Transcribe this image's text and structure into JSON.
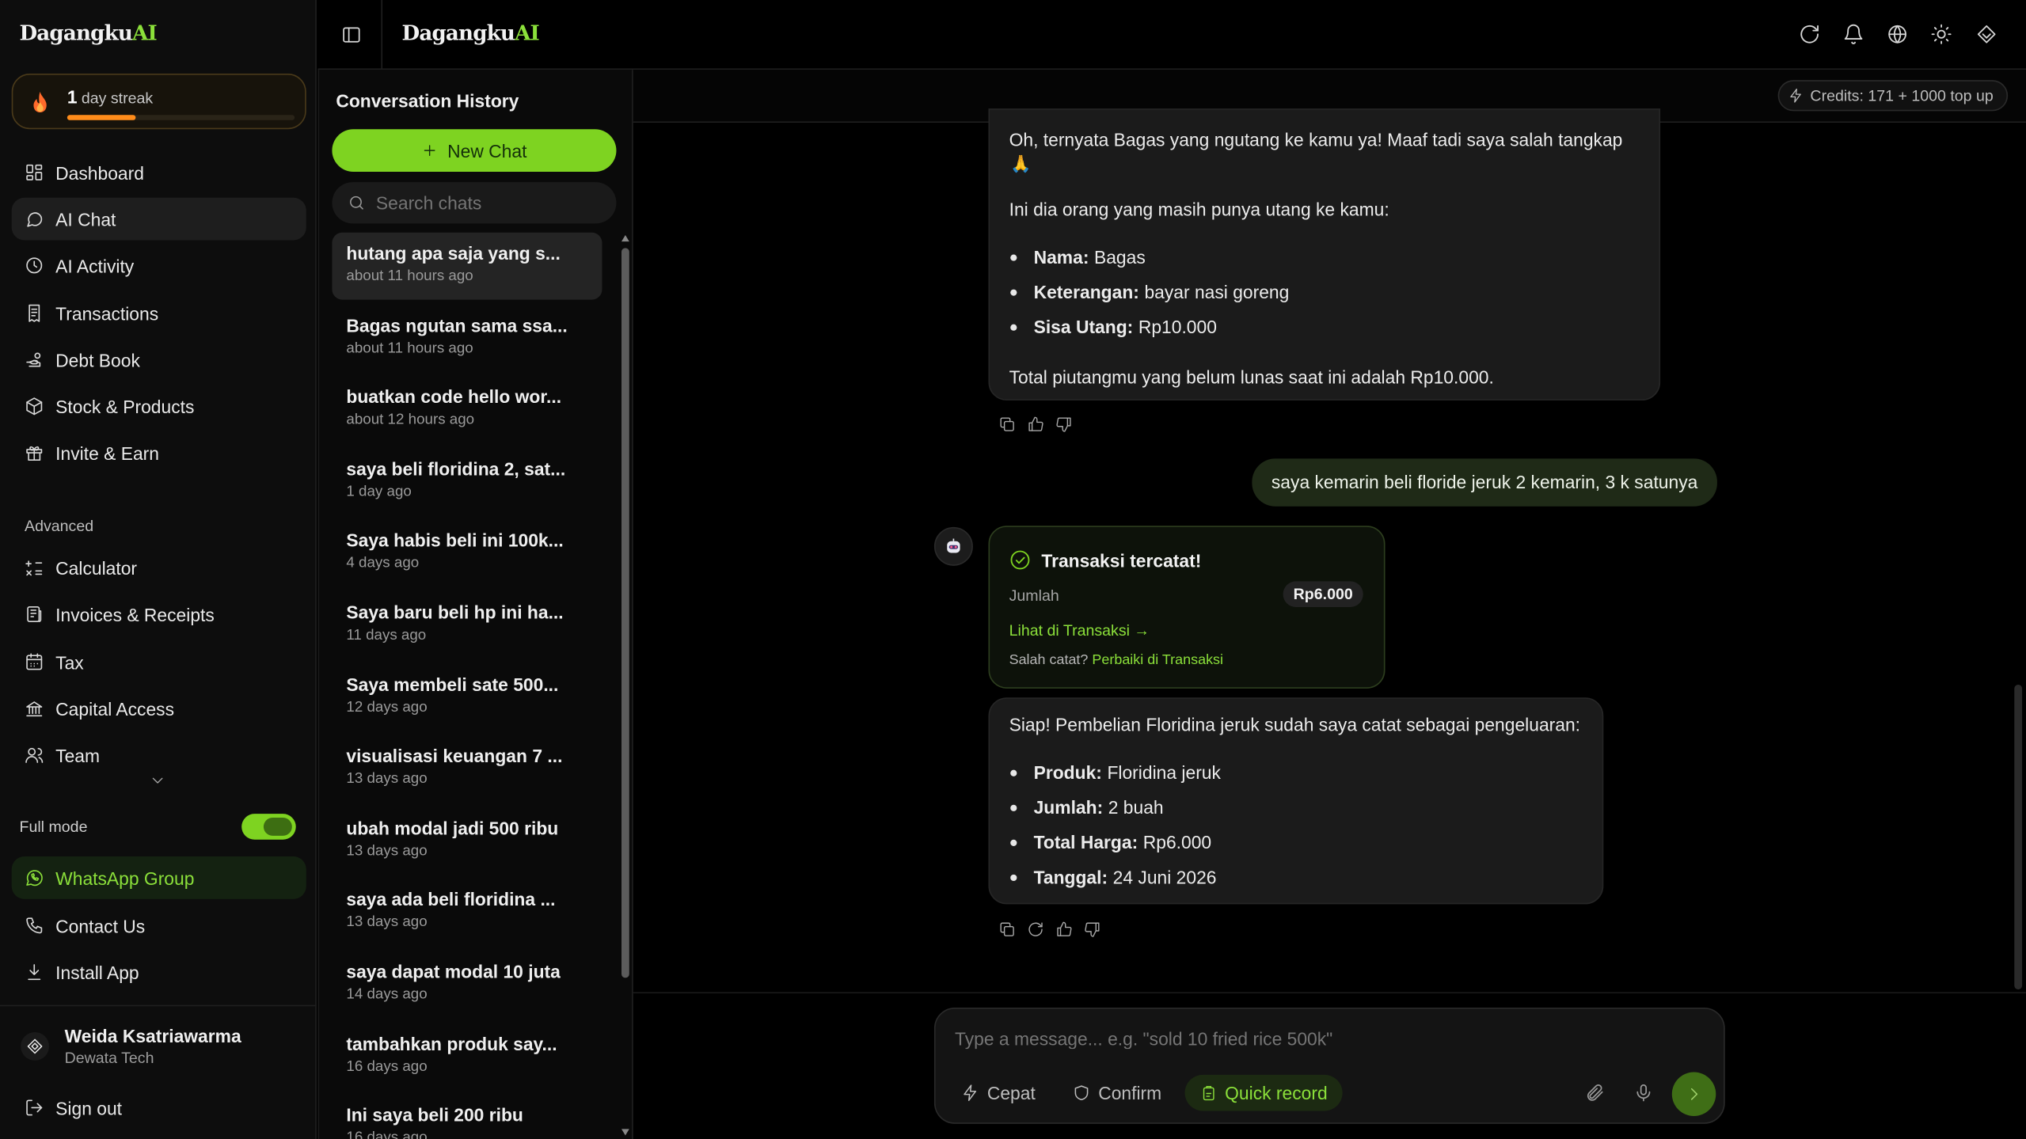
{
  "brand": {
    "name_prefix": "Dagangku",
    "name_suffix": "AI"
  },
  "streak": {
    "count": "1",
    "label": "day streak",
    "progress": 0.3
  },
  "nav": [
    {
      "label": "Dashboard",
      "icon": "dashboard-icon"
    },
    {
      "label": "AI Chat",
      "icon": "chat-icon",
      "active": true
    },
    {
      "label": "AI Activity",
      "icon": "activity-icon"
    },
    {
      "label": "Transactions",
      "icon": "receipt-icon"
    },
    {
      "label": "Debt Book",
      "icon": "hand-coins-icon"
    },
    {
      "label": "Stock & Products",
      "icon": "package-icon"
    },
    {
      "label": "Invite & Earn",
      "icon": "gift-icon"
    }
  ],
  "advanced_label": "Advanced",
  "advanced_nav": [
    {
      "label": "Calculator",
      "icon": "calculator-icon"
    },
    {
      "label": "Invoices & Receipts",
      "icon": "invoice-icon"
    },
    {
      "label": "Tax",
      "icon": "tax-icon"
    },
    {
      "label": "Capital Access",
      "icon": "bank-icon"
    },
    {
      "label": "Team",
      "icon": "users-icon"
    }
  ],
  "full_mode": {
    "label": "Full mode",
    "enabled": true
  },
  "bottom_nav": [
    {
      "label": "WhatsApp Group",
      "icon": "whatsapp-icon"
    },
    {
      "label": "Contact Us",
      "icon": "phone-icon"
    },
    {
      "label": "Install App",
      "icon": "download-icon"
    }
  ],
  "user": {
    "name": "Weida Ksatriawarma",
    "org": "Dewata Tech"
  },
  "sign_out": "Sign out",
  "credits": "Credits: 171 + 1000 top up",
  "history": {
    "title": "Conversation History",
    "new_chat": "New Chat",
    "search_placeholder": "Search chats",
    "items": [
      {
        "title": "hutang apa saja yang s...",
        "time": "about 11 hours ago"
      },
      {
        "title": "Bagas ngutan sama ssa...",
        "time": "about 11 hours ago"
      },
      {
        "title": "buatkan code hello wor...",
        "time": "about 12 hours ago"
      },
      {
        "title": "saya beli floridina 2, sat...",
        "time": "1 day ago"
      },
      {
        "title": "Saya habis beli ini 100k...",
        "time": "4 days ago"
      },
      {
        "title": "Saya baru beli hp ini ha...",
        "time": "11 days ago"
      },
      {
        "title": "Saya membeli sate 500...",
        "time": "12 days ago"
      },
      {
        "title": "visualisasi keuangan 7 ...",
        "time": "13 days ago"
      },
      {
        "title": "ubah modal jadi 500 ribu",
        "time": "13 days ago"
      },
      {
        "title": "saya ada beli floridina ...",
        "time": "13 days ago"
      },
      {
        "title": "saya dapat modal 10 juta",
        "time": "14 days ago"
      },
      {
        "title": "tambahkan produk say...",
        "time": "16 days ago"
      },
      {
        "title": "Ini saya beli 200 ribu",
        "time": "16 days ago"
      }
    ]
  },
  "chat": {
    "msg1": {
      "line1": "Oh, ternyata Bagas yang ngutang ke kamu ya! Maaf tadi saya salah tangkap",
      "emoji": "🙏",
      "intro": "Ini dia orang yang masih punya utang ke kamu:",
      "bullets": [
        {
          "k": "Nama:",
          "v": "Bagas"
        },
        {
          "k": "Keterangan:",
          "v": "bayar nasi goreng"
        },
        {
          "k": "Sisa Utang:",
          "v": "Rp10.000"
        }
      ],
      "footer": "Total piutangmu yang belum lunas saat ini adalah Rp10.000."
    },
    "user_msg": "saya kemarin beli floride jeruk 2 kemarin, 3 k satunya",
    "card": {
      "title": "Transaksi tercatat!",
      "amount_label": "Jumlah",
      "amount": "Rp6.000",
      "link": "Lihat di Transaksi →",
      "fix_prefix": "Salah catat?",
      "fix_link": "Perbaiki di Transaksi"
    },
    "msg2": {
      "intro": "Siap! Pembelian Floridina jeruk sudah saya catat sebagai pengeluaran:",
      "bullets": [
        {
          "k": "Produk:",
          "v": "Floridina jeruk"
        },
        {
          "k": "Jumlah:",
          "v": "2 buah"
        },
        {
          "k": "Total Harga:",
          "v": "Rp6.000"
        },
        {
          "k": "Tanggal:",
          "v": "24 Juni 2026"
        }
      ]
    }
  },
  "composer": {
    "placeholder": "Type a message... e.g. \"sold 10 fried rice 500k\"",
    "modes": [
      "Cepat",
      "Confirm",
      "Quick record"
    ]
  },
  "colors": {
    "accent": "#7ed321",
    "accent_text": "#8be03a",
    "bg": "#000000",
    "sidebar": "#0d0d0d"
  }
}
